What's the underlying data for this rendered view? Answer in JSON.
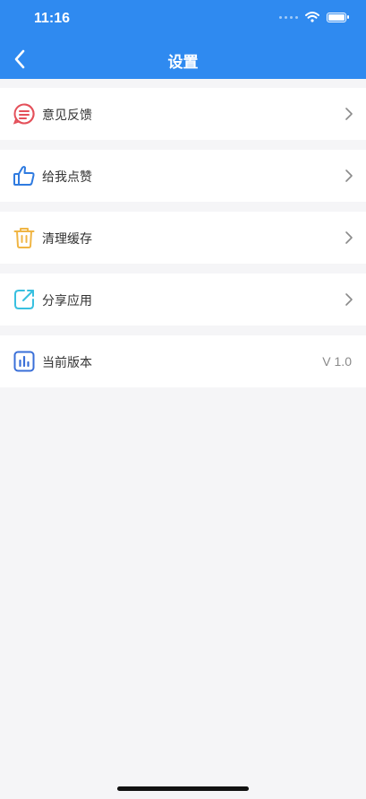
{
  "status_bar": {
    "time": "11:16"
  },
  "nav": {
    "title": "设置"
  },
  "settings": {
    "items": [
      {
        "label": "意见反馈",
        "icon": "feedback-icon",
        "color": "#e4505a"
      },
      {
        "label": "给我点赞",
        "icon": "thumbs-up-icon",
        "color": "#2f7be0"
      },
      {
        "label": "清理缓存",
        "icon": "trash-icon",
        "color": "#f0b544"
      },
      {
        "label": "分享应用",
        "icon": "share-icon",
        "color": "#38c0e0"
      },
      {
        "label": "当前版本",
        "icon": "version-chart-icon",
        "color": "#3a6fd8",
        "value": "V 1.0"
      }
    ]
  },
  "colors": {
    "header": "#2f8af0",
    "background": "#f5f5f7"
  }
}
